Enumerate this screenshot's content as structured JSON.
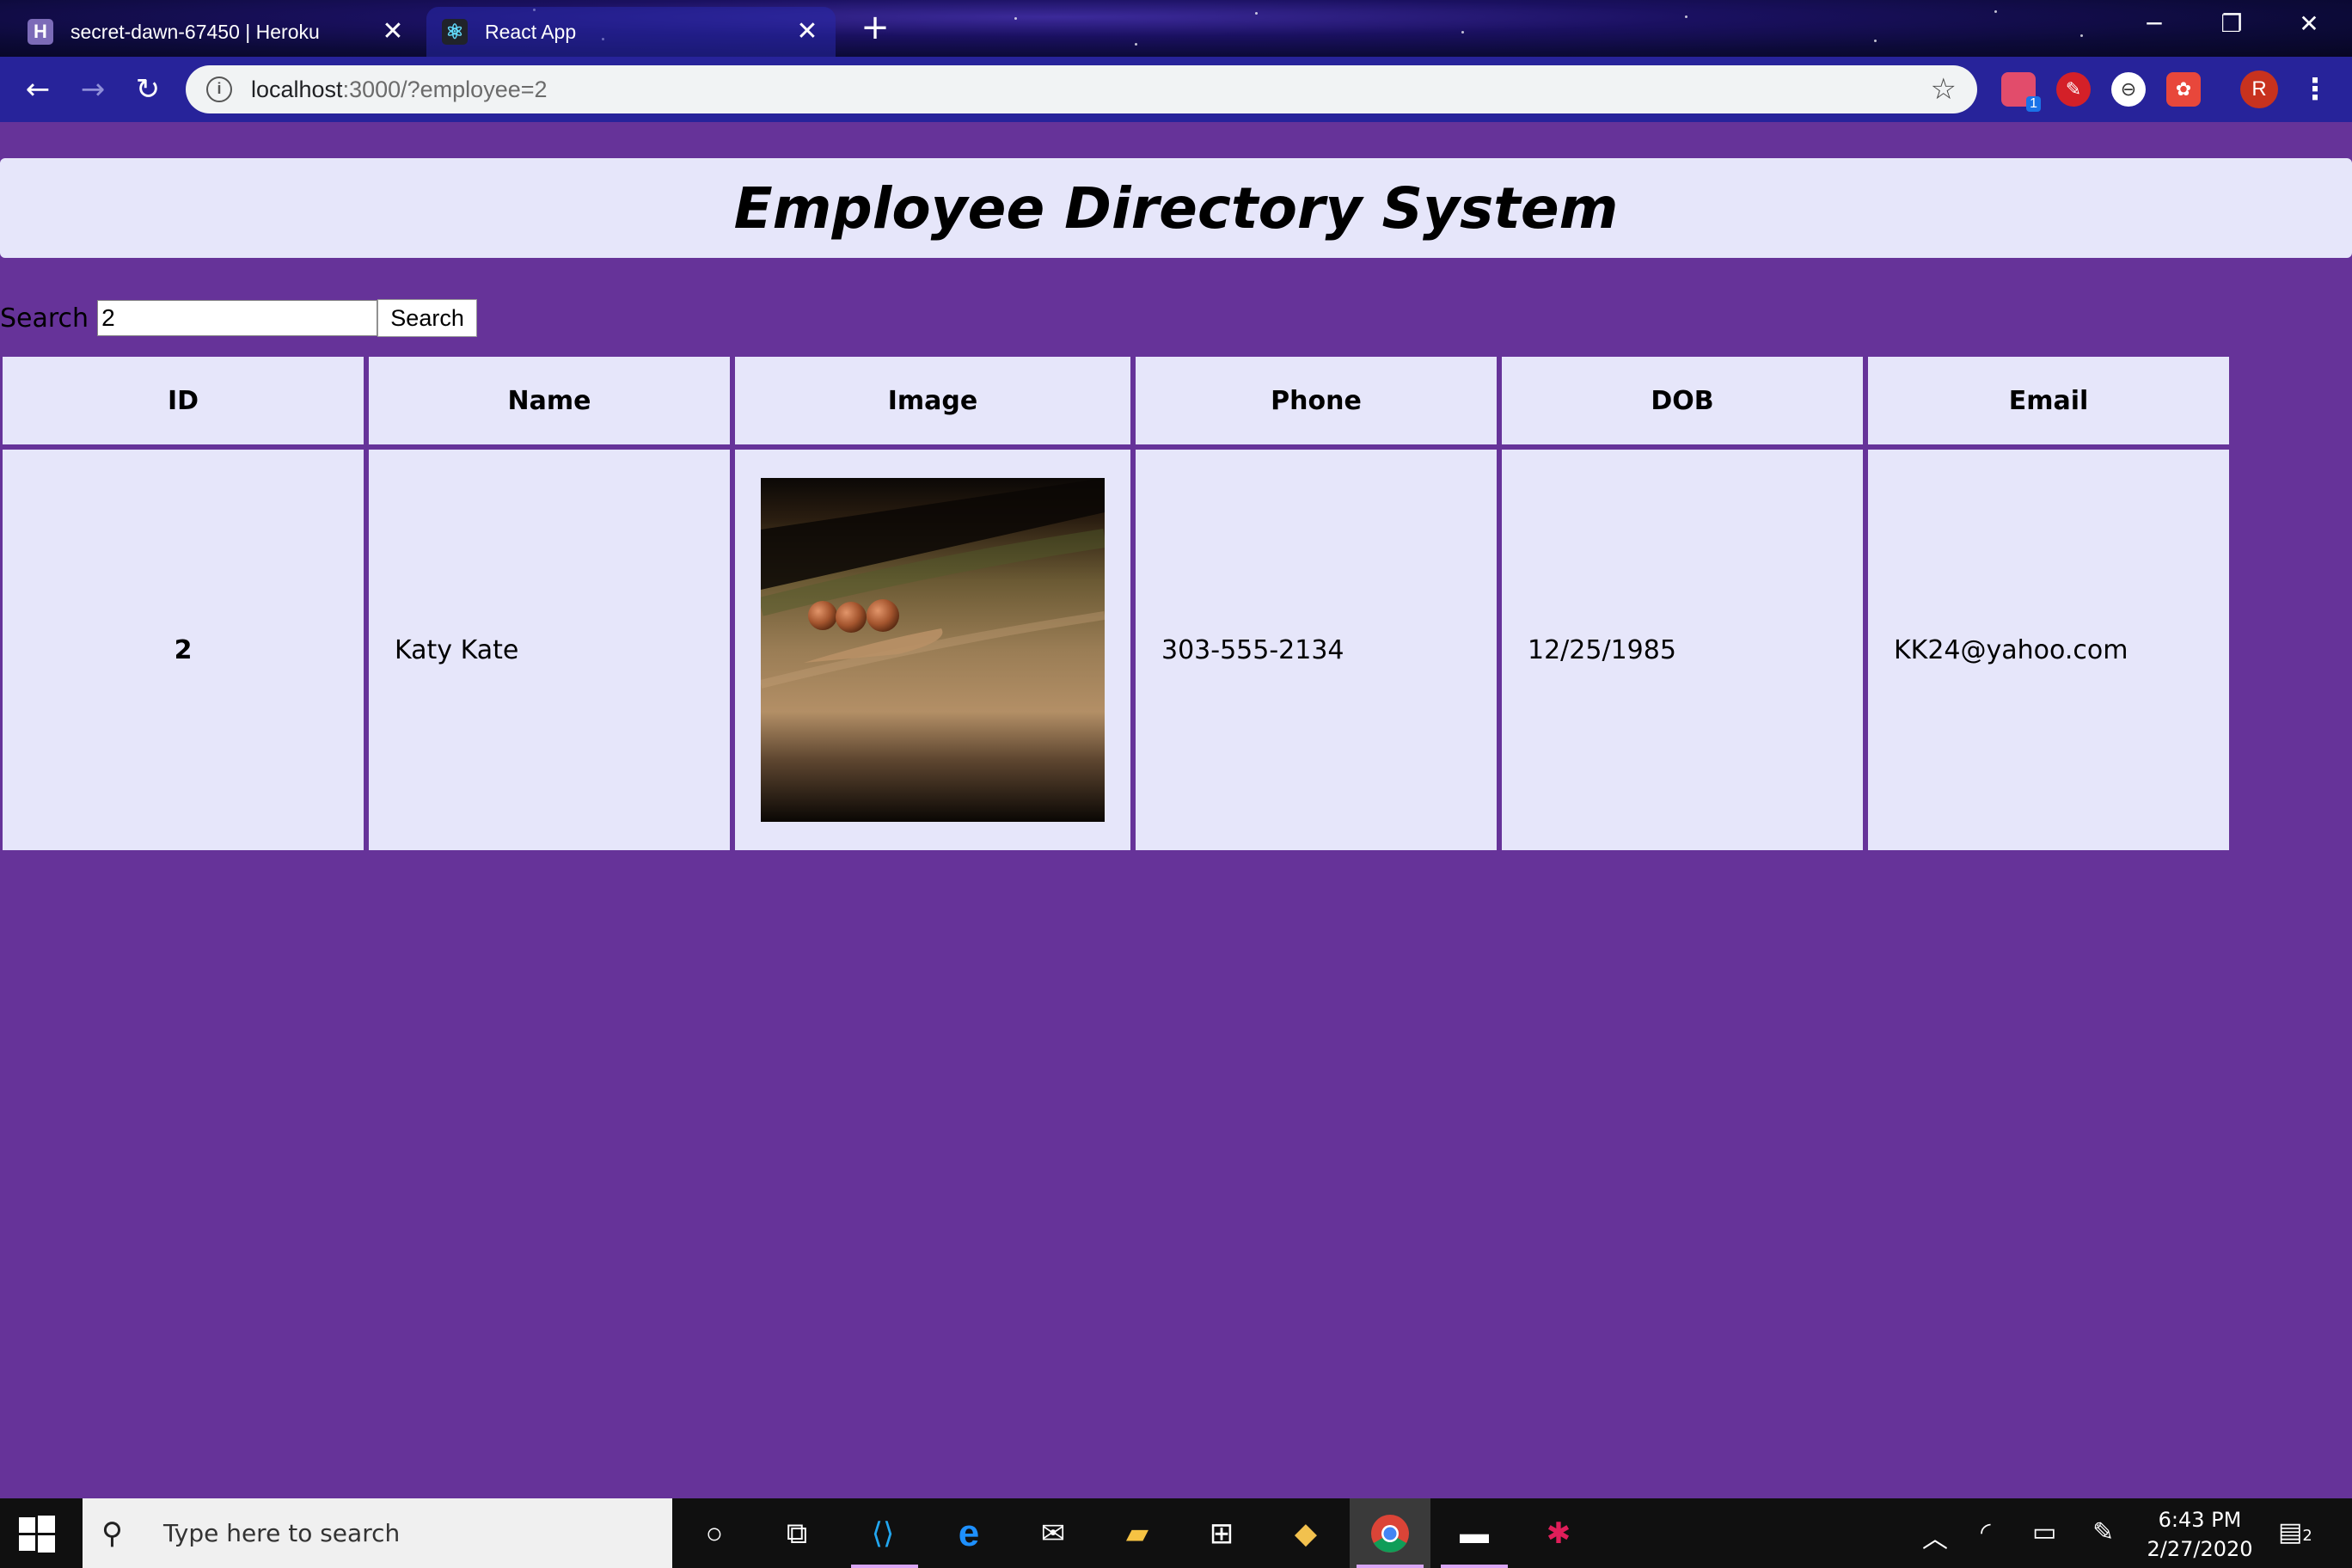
{
  "browser": {
    "tabs": [
      {
        "title": "secret-dawn-67450 | Heroku",
        "favicon": "heroku-icon",
        "active": false
      },
      {
        "title": "React App",
        "favicon": "react-icon",
        "active": true
      }
    ],
    "new_tab_label": "+",
    "url": {
      "host": "localhost",
      "path": ":3000/?employee=2"
    },
    "profile_initial": "R",
    "extension_badge": "1"
  },
  "page": {
    "title": "Employee Directory System",
    "search": {
      "label": "Search",
      "value": "2",
      "button_label": "Search"
    },
    "table": {
      "columns": [
        "ID",
        "Name",
        "Image",
        "Phone",
        "DOB",
        "Email"
      ],
      "rows": [
        {
          "id": "2",
          "name": "Katy Kate",
          "image": "employee-photo",
          "phone": "303-555-2134",
          "dob": "12/25/1985",
          "email": "KK24@yahoo.com"
        }
      ]
    }
  },
  "taskbar": {
    "search_placeholder": "Type here to search",
    "time": "6:43 PM",
    "date": "2/27/2020",
    "notification_count": "2"
  },
  "colors": {
    "page_background": "#663399",
    "panel_background": "#e6e6fa"
  }
}
